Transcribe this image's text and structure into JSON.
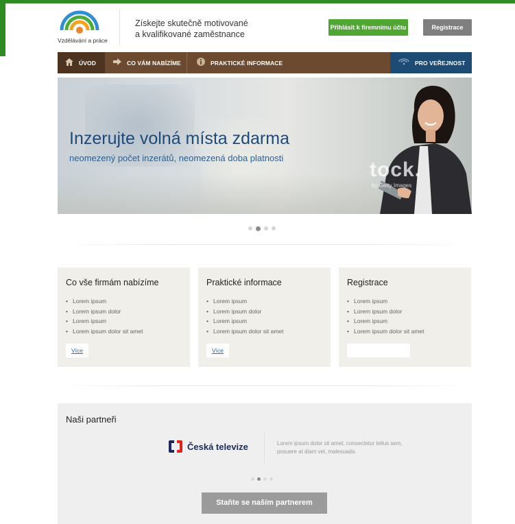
{
  "header": {
    "logo_text": "Vzdělávání a práce",
    "tagline_line1": "Získejte skutečně motivované",
    "tagline_line2": "a kvalifikované zaměstnance",
    "login_button": "Přihlásit k firemnímu účtu",
    "register_button": "Registrace"
  },
  "nav": {
    "items": [
      {
        "label": "ÚVOD",
        "icon": "home-icon"
      },
      {
        "label": "CO VÁM NABÍZÍME",
        "icon": "arrow-right-icon"
      },
      {
        "label": "PRAKTICKÉ INFORMACE",
        "icon": "info-icon"
      },
      {
        "label": "PRO VEŘEJNOST",
        "icon": "signal-icon"
      }
    ]
  },
  "hero": {
    "title": "Inzerujte volná místa zdarma",
    "subtitle": "neomezený počet inzerátů, neomezená doba platnosti",
    "watermark": "tock.",
    "watermark_sub": "by Getty Images",
    "slides_count": 4,
    "active_slide": 2
  },
  "boxes": [
    {
      "title": "Co vše firmám nabízíme",
      "items": [
        "Lorem ipsum",
        "Lorem ipsum dolor",
        "Lorem ipsum",
        "Lorem ipsum dolor sit amet"
      ],
      "button": "Více"
    },
    {
      "title": "Praktické informace",
      "items": [
        "Lorem ipsum",
        "Lorem ipsum dolor",
        "Lorem ipsum",
        "Lorem ipsum dolor sit amet"
      ],
      "button": "Více"
    },
    {
      "title": "Registrace",
      "items": [
        "Lorem ipsum",
        "Lorem ipsum dolor",
        "Lorem ipsum",
        "Lorem ipsum dolor sit amet"
      ],
      "button": ""
    }
  ],
  "partners": {
    "title": "Naši partneři",
    "partner_name": "Česká televize",
    "description": "Lorem ipsum dolor sit amet, consectetur tellus sem, posuere at diam vel, malesuada.",
    "slides_count": 4,
    "active_slide": 2,
    "cta_button": "Staňte se naším partnerem"
  },
  "colors": {
    "brand_green": "#2e8b1f",
    "nav_brown": "#6b4a2f",
    "nav_blue": "#1d4b73",
    "hero_text": "#1e4a7a"
  }
}
